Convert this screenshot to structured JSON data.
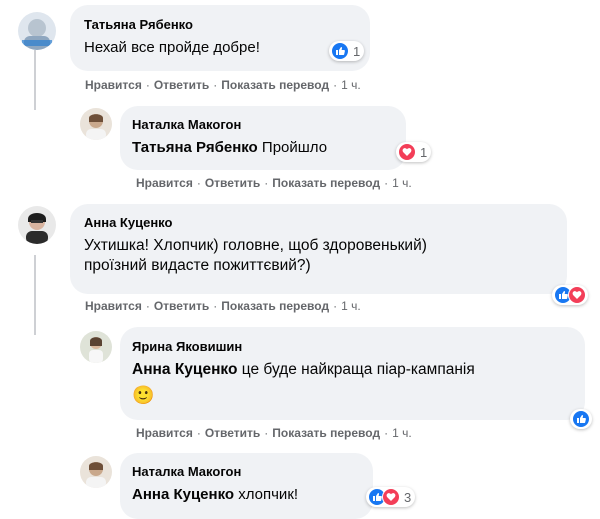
{
  "colors": {
    "bubble": "#f0f2f5",
    "meta": "#65676b",
    "like": "#1877f2",
    "love": "#f33e58"
  },
  "actions": {
    "like": "Нравится",
    "reply": "Ответить",
    "translate": "Показать перевод",
    "dot": "·"
  },
  "comments": [
    {
      "author": "Татьяна Рябенко",
      "text": "Нехай все пройде добре!",
      "time": "1 ч.",
      "reactions": {
        "icons": [
          "like-icon"
        ],
        "count": "1"
      }
    },
    {
      "author": "Наталка Макогон",
      "mention": "Татьяна Рябенко",
      "text": "Пройшло",
      "time": "1 ч.",
      "reactions": {
        "icons": [
          "love-icon"
        ],
        "count": "1"
      }
    },
    {
      "author": "Анна Куценко",
      "text_line1": "Ухтишка! Хлопчик) головне, щоб здоровенький)",
      "text_line2": "проїзний видасте пожиттєвий?)",
      "time": "1 ч.",
      "reactions": {
        "icons": [
          "like-icon",
          "love-icon"
        ],
        "count": ""
      }
    },
    {
      "author": "Ярина Яковишин",
      "mention": "Анна Куценко",
      "text": "це буде найкраща піар-кампанія",
      "emoji": "🙂",
      "time": "1 ч.",
      "reactions": {
        "icons": [
          "like-icon"
        ],
        "count": ""
      }
    },
    {
      "author": "Наталка Макогон",
      "mention": "Анна Куценко",
      "text": "хлопчик!",
      "reactions": {
        "icons": [
          "like-icon",
          "love-icon"
        ],
        "count": "3"
      }
    }
  ]
}
